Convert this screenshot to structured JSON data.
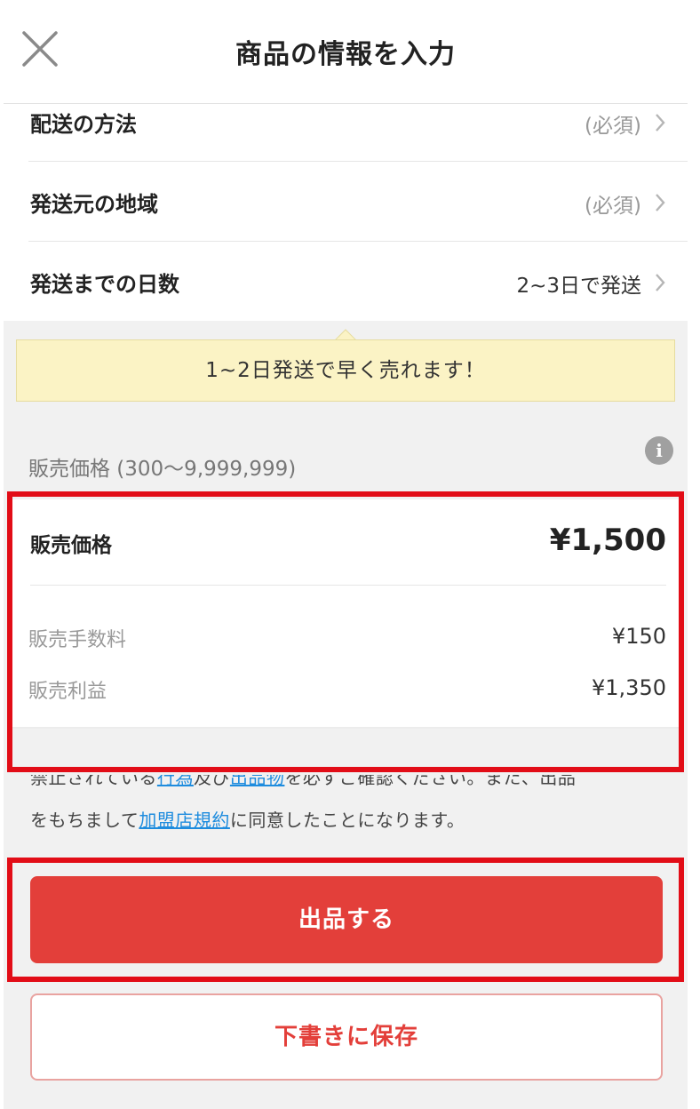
{
  "header": {
    "title": "商品の情報を入力",
    "close_icon": "close-x-icon"
  },
  "shipping": {
    "rows": [
      {
        "label": "配送の方法",
        "value": "(必須)"
      },
      {
        "label": "発送元の地域",
        "value": "(必須)"
      },
      {
        "label": "発送までの日数",
        "value": "2~3日で発送"
      }
    ],
    "chevron_icon": "chevron-right-icon"
  },
  "tip": {
    "text": "1~2日発送で早く売れます！"
  },
  "price": {
    "range_label": "販売価格 (300〜9,999,999)",
    "info_icon_glyph": "i",
    "price_label": "販売価格",
    "price_value": "¥1,500",
    "fee_label": "販売手数料",
    "fee_value": "¥150",
    "profit_label": "販売利益",
    "profit_value": "¥1,350"
  },
  "terms": {
    "part1": "禁止されている",
    "link1": "行為",
    "part2": "及び",
    "link2": "出品物",
    "part3": "を必ずご確認ください。また、出品",
    "part4": "をもちまして",
    "link3": "加盟店規約",
    "part5": "に同意したことになります。"
  },
  "actions": {
    "submit_label": "出品する",
    "draft_label": "下書きに保存"
  },
  "colors": {
    "accent": "#e33f3a",
    "highlight": "#e20d17",
    "link": "#1e8cde",
    "tip_bg": "#fbf3c5"
  }
}
